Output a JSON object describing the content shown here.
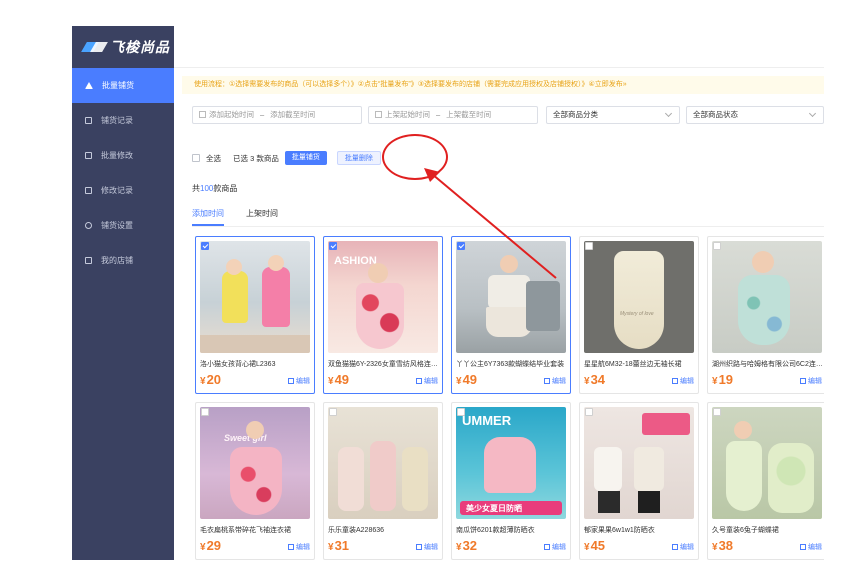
{
  "brand": {
    "name": "飞梭尚品"
  },
  "sidebar": {
    "items": [
      {
        "label": "批量铺货",
        "icon": "home-icon",
        "active": true
      },
      {
        "label": "铺货记录",
        "icon": "list-icon"
      },
      {
        "label": "批量修改",
        "icon": "edit-icon"
      },
      {
        "label": "修改记录",
        "icon": "doc-icon"
      },
      {
        "label": "铺货设置",
        "icon": "gear-icon"
      },
      {
        "label": "我的店铺",
        "icon": "store-icon"
      }
    ]
  },
  "notice": {
    "text": "使用流程：①选择需要发布的商品（可以选择多个）》②点击“批量发布”》③选择要发布的店铺（需要完成应用授权及店铺授权）》④立即发布»"
  },
  "filters": {
    "start_placeholder": "添加起始时间",
    "end_placeholder": "添加截至时间",
    "shelf_start_placeholder": "上架起始时间",
    "shelf_end_placeholder": "上架截至时间",
    "dash": "–",
    "category": "全部商品分类",
    "status": "全部商品状态"
  },
  "toolbar": {
    "select_all": "全选",
    "selected_prefix": "已选",
    "selected_count": "3",
    "selected_suffix": "款商品",
    "batch_list": "批量铺货",
    "batch_delete": "批量删除"
  },
  "summary": {
    "prefix": "共",
    "count": "100",
    "suffix": "款商品"
  },
  "tabs": [
    {
      "label": "添加时间",
      "active": true
    },
    {
      "label": "上架时间",
      "active": false
    }
  ],
  "products": [
    {
      "title": "洛小猫女孩背心裙L2363",
      "currency": "¥",
      "price": "20",
      "edit": "编辑",
      "checked": true
    },
    {
      "title": "双鱼猫猫6Y-2326女童雪纺风格连衣裙",
      "currency": "¥",
      "price": "49",
      "edit": "编辑",
      "checked": true
    },
    {
      "title": "丫丫公主6Y7363款蝴蝶结毕业套装",
      "currency": "¥",
      "price": "49",
      "edit": "编辑",
      "checked": true
    },
    {
      "title": "星星航6M32-18蕾丝边无袖长裙",
      "currency": "¥",
      "price": "34",
      "edit": "编辑",
      "checked": false
    },
    {
      "title": "湖州织路与哈姆格有限公司6C2连衣裙",
      "currency": "¥",
      "price": "19",
      "edit": "编辑",
      "checked": false
    },
    {
      "title": "毛衣扁桃系带碎花飞袖连衣裙",
      "currency": "¥",
      "price": "29",
      "edit": "编辑",
      "checked": false
    },
    {
      "title": "乐乐童装A228636",
      "currency": "¥",
      "price": "31",
      "edit": "编辑",
      "checked": false
    },
    {
      "title": "南瓜饼6201款超薄防晒衣",
      "currency": "¥",
      "price": "32",
      "edit": "编辑",
      "checked": false
    },
    {
      "title": "郁家果果6w1w1防晒衣",
      "currency": "¥",
      "price": "45",
      "edit": "编辑",
      "checked": false
    },
    {
      "title": "久号童装6兔子蝴蝶裙",
      "currency": "¥",
      "price": "38",
      "edit": "编辑",
      "checked": false
    }
  ],
  "image_text": {
    "p2": "ASHION",
    "p4": "Mystery of love",
    "p6": "Sweet girl",
    "p8_top": "UMMER",
    "p8_bottom": "美少女夏日防晒"
  },
  "colors": {
    "accent": "#4a7dff",
    "sidebar": "#3a4161",
    "price": "#f07a2a",
    "annotation": "#e02020"
  }
}
